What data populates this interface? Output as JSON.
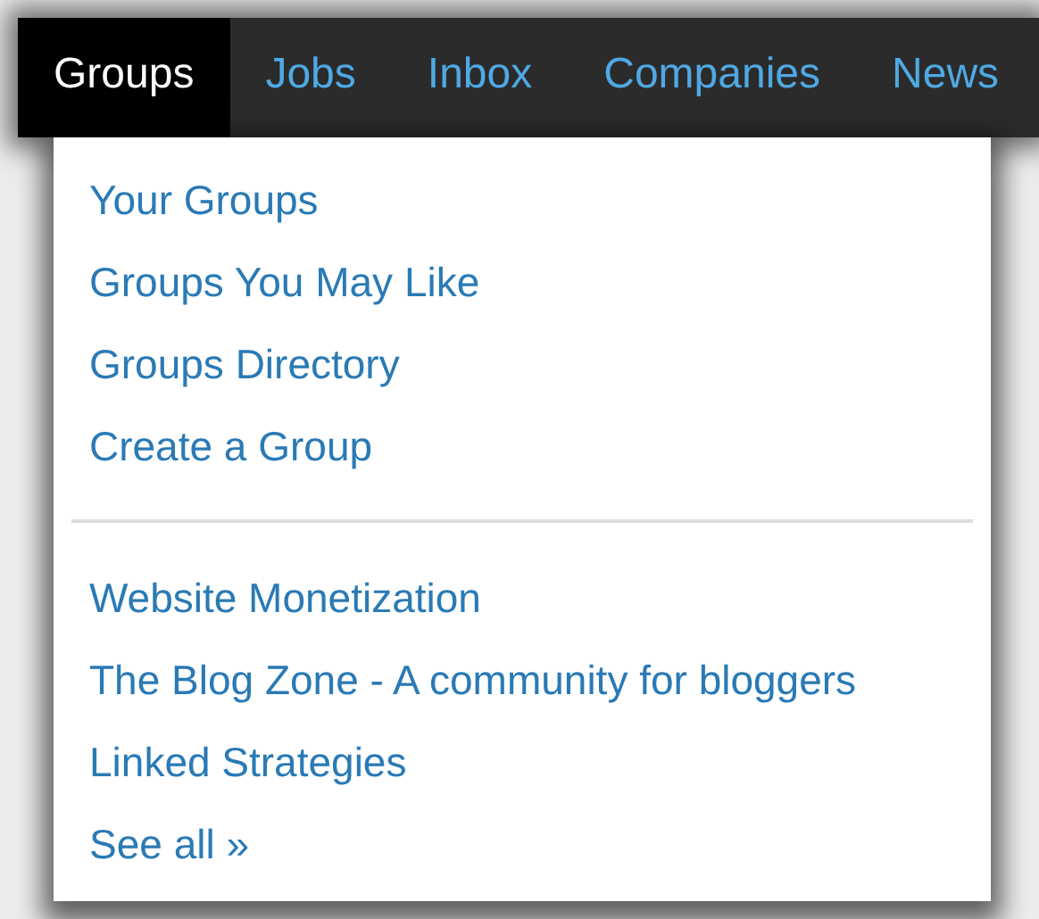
{
  "nav": {
    "tabs": [
      {
        "label": "Groups",
        "selected": true
      },
      {
        "label": "Jobs",
        "selected": false
      },
      {
        "label": "Inbox",
        "selected": false
      },
      {
        "label": "Companies",
        "selected": false
      },
      {
        "label": "News",
        "selected": false
      }
    ]
  },
  "dropdown": {
    "sections": [
      {
        "items": [
          "Your Groups",
          "Groups You May Like",
          "Groups Directory",
          "Create a Group"
        ]
      },
      {
        "items": [
          "Website Monetization",
          "The Blog Zone - A community for bloggers",
          "Linked Strategies",
          "See all »"
        ]
      }
    ]
  }
}
